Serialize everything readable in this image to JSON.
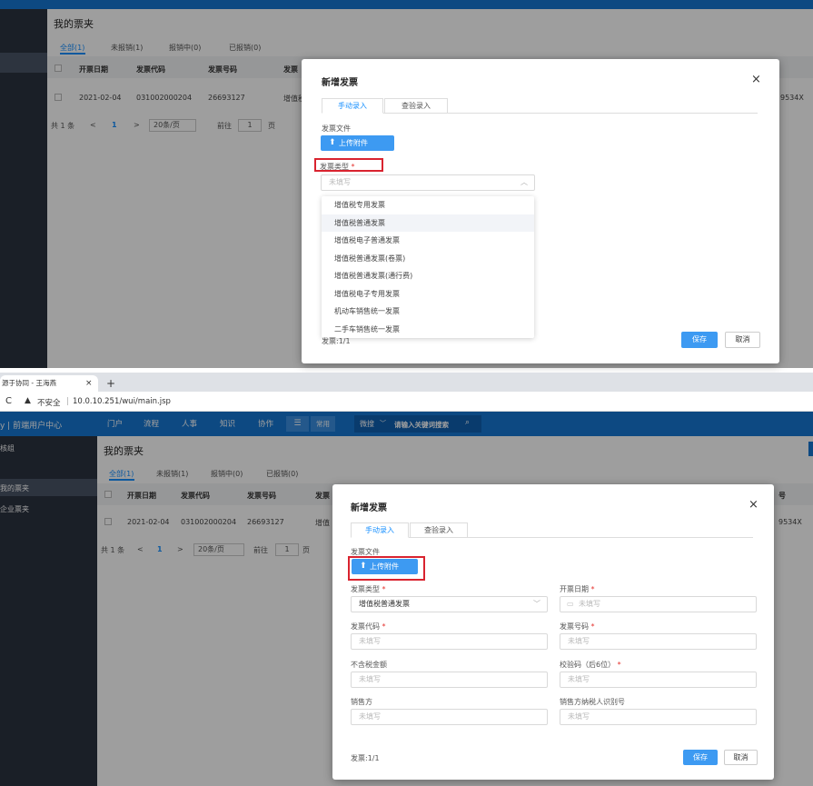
{
  "top": {
    "page_title": "我的票夹",
    "tabs": [
      "全部(1)",
      "未报销(1)",
      "报销中(0)",
      "已报销(0)"
    ],
    "table_headers": [
      "开票日期",
      "发票代码",
      "发票号码",
      "发票"
    ],
    "row": {
      "date": "2021-02-04",
      "code": "031002000204",
      "number": "26693127",
      "type": "增值税",
      "right_tail": "9534X"
    },
    "pager": {
      "total": "共 1 条",
      "prev": "<",
      "page": "1",
      "next": ">",
      "size": "20条/页",
      "goto": "前往",
      "goto_value": "1",
      "page_unit": "页"
    },
    "modal": {
      "title": "新增发票",
      "close": "×",
      "tab_manual": "手动录入",
      "tab_check": "查验录入",
      "file_label": "发票文件",
      "upload": "上传附件",
      "type_label": "发票类型",
      "type_placeholder": "未填写",
      "options": [
        "增值税专用发票",
        "增值税普通发票",
        "增值税电子普通发票",
        "增值税普通发票(卷票)",
        "增值税普通发票(通行费)",
        "增值税电子专用发票",
        "机动车销售统一发票",
        "二手车销售统一发票"
      ],
      "footer_count": "发票:1/1",
      "save": "保存",
      "cancel": "取消"
    }
  },
  "bottom": {
    "browser": {
      "tab_title": "源于协同 - 王海燕",
      "new_tab": "+",
      "reload": "C",
      "security": "不安全",
      "url": "10.0.10.251/wui/main.jsp"
    },
    "nav": {
      "brand": "y | 前端用户中心",
      "items": [
        "门户",
        "流程",
        "人事",
        "知识",
        "协作"
      ],
      "common": "常用",
      "search_mode": "微搜",
      "search_placeholder": "请输入关键词搜索"
    },
    "sidebar": {
      "group": "核组",
      "items": [
        "我的票夹",
        "企业票夹"
      ]
    },
    "page_title": "我的票夹",
    "tabs": [
      "全部(1)",
      "未报销(1)",
      "报销中(0)",
      "已报销(0)"
    ],
    "table_headers": [
      "开票日期",
      "发票代码",
      "发票号码",
      "发票",
      "号"
    ],
    "row": {
      "date": "2021-02-04",
      "code": "031002000204",
      "number": "26693127",
      "type": "增值",
      "right_tail": "9534X"
    },
    "pager": {
      "total": "共 1 条",
      "prev": "<",
      "page": "1",
      "next": ">",
      "size": "20条/页",
      "goto": "前往",
      "goto_value": "1",
      "page_unit": "页"
    },
    "modal": {
      "title": "新增发票",
      "close": "×",
      "tab_manual": "手动录入",
      "tab_check": "查验录入",
      "file_label": "发票文件",
      "upload": "上传附件",
      "fields": {
        "type_label": "发票类型",
        "type_value": "增值税普通发票",
        "date_label": "开票日期",
        "date_placeholder": "未填写",
        "code_label": "发票代码",
        "code_placeholder": "未填写",
        "number_label": "发票号码",
        "number_placeholder": "未填写",
        "amount_label": "不含税金额",
        "amount_placeholder": "未填写",
        "check_label": "校验码（后6位）",
        "check_placeholder": "未填写",
        "seller_label": "销售方",
        "seller_placeholder": "未填写",
        "seller_tax_label": "销售方纳税人识别号",
        "seller_tax_placeholder": "未填写"
      },
      "footer_count": "发票:1/1",
      "save": "保存",
      "cancel": "取消"
    }
  },
  "colors": {
    "primary": "#1890ff",
    "button": "#3d9af2",
    "nav": "#1677d2",
    "sidebar": "#2b3240",
    "highlight_box": "#d9232f",
    "required": "#e5322d"
  }
}
